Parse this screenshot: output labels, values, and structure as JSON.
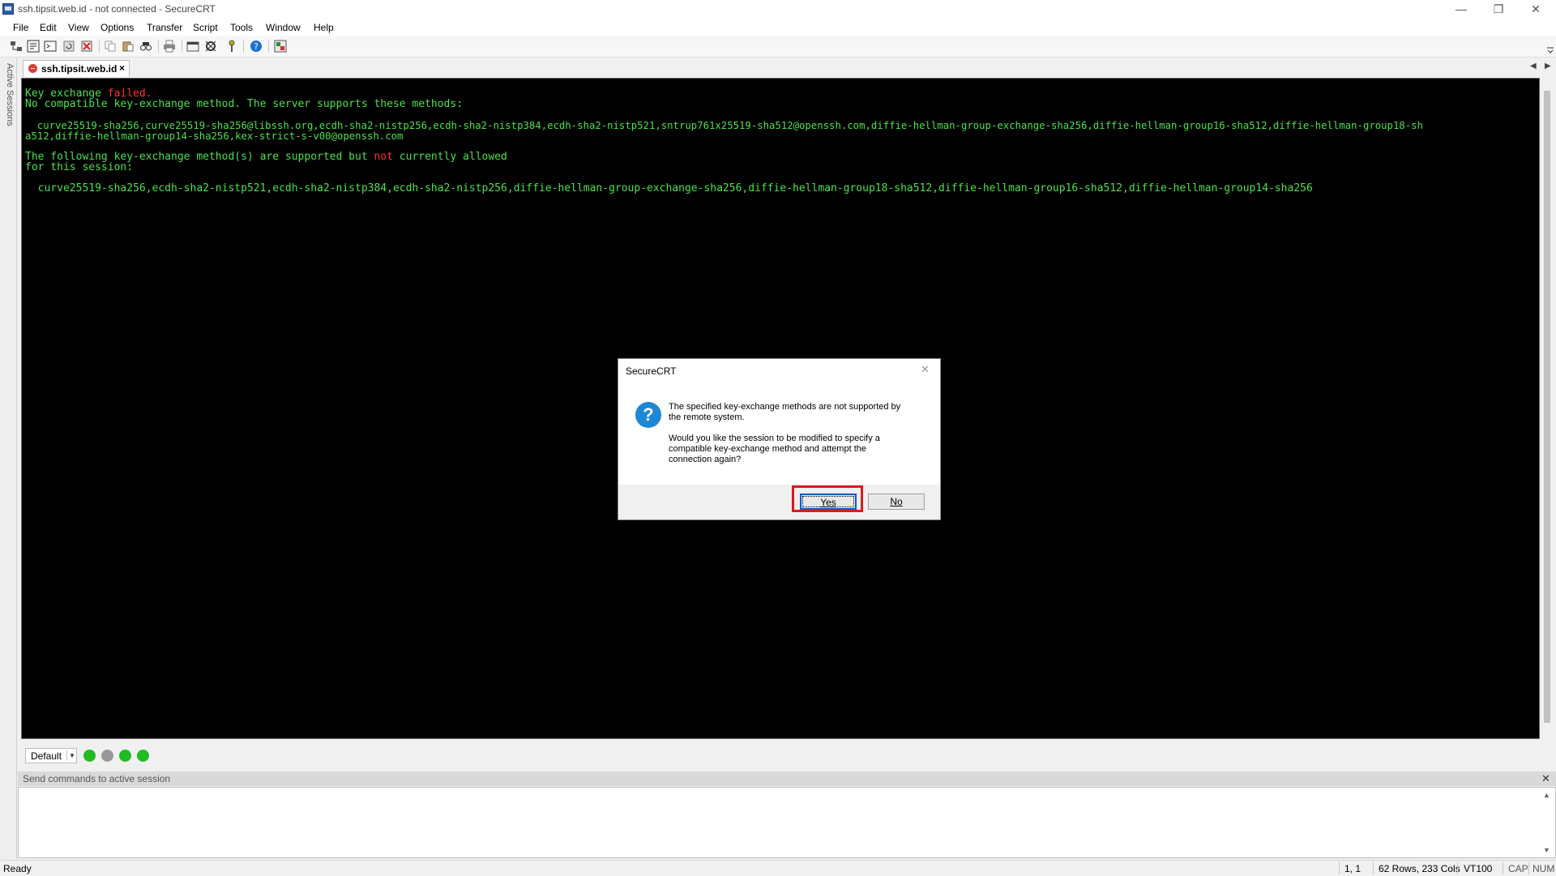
{
  "window": {
    "title": "ssh.tipsit.web.id - not connected - SecureCRT",
    "minimize_glyph": "—",
    "restore_glyph": "❐",
    "close_glyph": "✕"
  },
  "menu": [
    "File",
    "Edit",
    "View",
    "Options",
    "Transfer",
    "Script",
    "Tools",
    "Window",
    "Help"
  ],
  "side_panel": {
    "label": "Active Sessions"
  },
  "tab": {
    "label": "ssh.tipsit.web.id",
    "close": "×",
    "status": "disconnected"
  },
  "terminal": {
    "line1_a": "Key exchange ",
    "line1_b": "failed",
    "line1_c": ".",
    "line2": "No compatible key-exchange method. The server supports these methods:",
    "line3": "  curve25519-sha256,curve25519-sha256@libssh.org,ecdh-sha2-nistp256,ecdh-sha2-nistp384,ecdh-sha2-nistp521,sntrup761x25519-sha512@openssh.com,diffie-hellman-group-exchange-sha256,diffie-hellman-group16-sha512,diffie-hellman-group18-sh",
    "line4": "a512,diffie-hellman-group14-sha256,kex-strict-s-v00@openssh.com",
    "line5_a": "The following key-exchange method(s) are supported but ",
    "line5_b": "not",
    "line5_c": " currently allowed",
    "line6": "for this session:",
    "line7": "  curve25519-sha256,ecdh-sha2-nistp521,ecdh-sha2-nistp384,ecdh-sha2-nistp256,diffie-hellman-group-exchange-sha256,diffie-hellman-group18-sha512,diffie-hellman-group16-sha512,diffie-hellman-group14-sha256"
  },
  "dialog": {
    "title": "SecureCRT",
    "close": "✕",
    "icon": "?",
    "message1_l1": "The specified key-exchange methods are not supported by",
    "message1_l2": "the remote system.",
    "message2_l1": "Would you like the session to be modified to specify a",
    "message2_l2": "compatible key-exchange method and attempt the",
    "message2_l3": "connection again?",
    "yes_label": "Yes",
    "no_label": "No"
  },
  "button_bar": {
    "selected": "Default",
    "dots": [
      "#22bb22",
      "#999999",
      "#22bb22",
      "#22bb22"
    ]
  },
  "command_window": {
    "header": "Send commands to active session",
    "close": "✕"
  },
  "status": {
    "ready": "Ready",
    "cursor": "1,  1",
    "size": "62 Rows, 233 Cols",
    "emulation": "VT100",
    "cap": "CAP",
    "num": "NUM"
  },
  "colors": {
    "terminal_text": "#4ce04c",
    "terminal_error": "#ff3030",
    "terminal_bg": "#000000",
    "highlight": "#e01818"
  }
}
